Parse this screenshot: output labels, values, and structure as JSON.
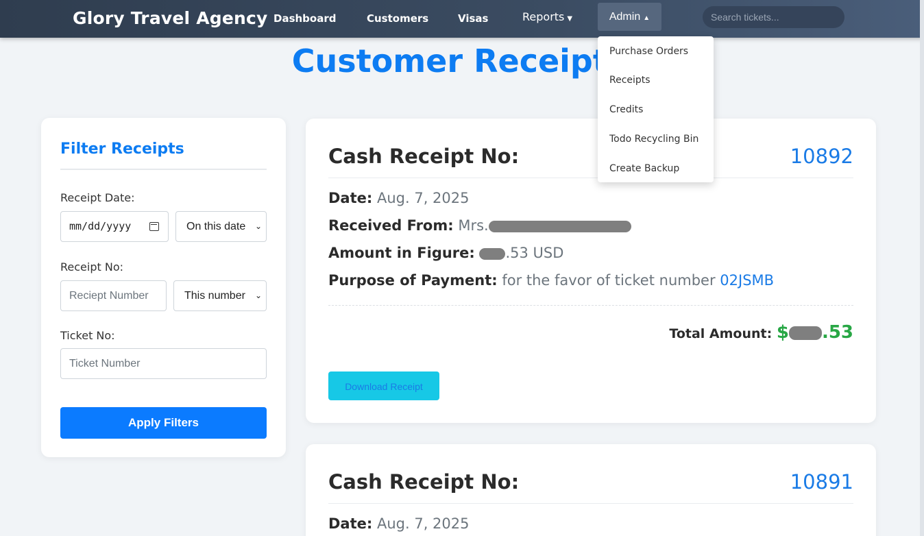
{
  "nav": {
    "brand": "Glory Travel Agency",
    "items": [
      {
        "label": "Dashboard"
      },
      {
        "label": "Customers"
      },
      {
        "label": "Visas"
      },
      {
        "label": "Reports"
      },
      {
        "label": "Admin"
      }
    ],
    "search_placeholder": "Search tickets..."
  },
  "admin_menu": {
    "items": [
      {
        "label": "Purchase Orders"
      },
      {
        "label": "Receipts"
      },
      {
        "label": "Credits"
      },
      {
        "label": "Todo Recycling Bin"
      },
      {
        "label": "Create Backup"
      }
    ]
  },
  "page": {
    "title": "Customer Receipts"
  },
  "filter": {
    "title": "Filter Receipts",
    "receipt_date_label": "Receipt Date:",
    "date_placeholder": "mm/dd/yyyy",
    "date_mode": "On this date",
    "receipt_no_label": "Receipt No:",
    "receipt_no_placeholder": "Reciept Number",
    "number_mode": "This number",
    "ticket_no_label": "Ticket No:",
    "ticket_no_placeholder": "Ticket Number",
    "apply_label": "Apply Filters"
  },
  "receipts": [
    {
      "heading": "Cash Receipt No:",
      "number": "10892",
      "date_label": "Date:",
      "date": "Aug. 7, 2025",
      "received_from_label": "Received From:",
      "received_from_prefix": "Mrs.",
      "amount_label": "Amount in Figure:",
      "amount_suffix": ".53 USD",
      "purpose_label": "Purpose of Payment:",
      "purpose_text": "for the favor of ticket number",
      "ticket_number": "02JSMB",
      "total_label": "Total Amount:",
      "total_prefix": "$",
      "total_suffix": ".53",
      "download_label": "Download Receipt"
    },
    {
      "heading": "Cash Receipt No:",
      "number": "10891",
      "date_label": "Date:",
      "date": "Aug. 7, 2025"
    }
  ],
  "colors": {
    "accent": "#0d7cf2",
    "total_green": "#28a745",
    "download_button": "#17c8e6",
    "apply_button": "#0b7bff"
  }
}
